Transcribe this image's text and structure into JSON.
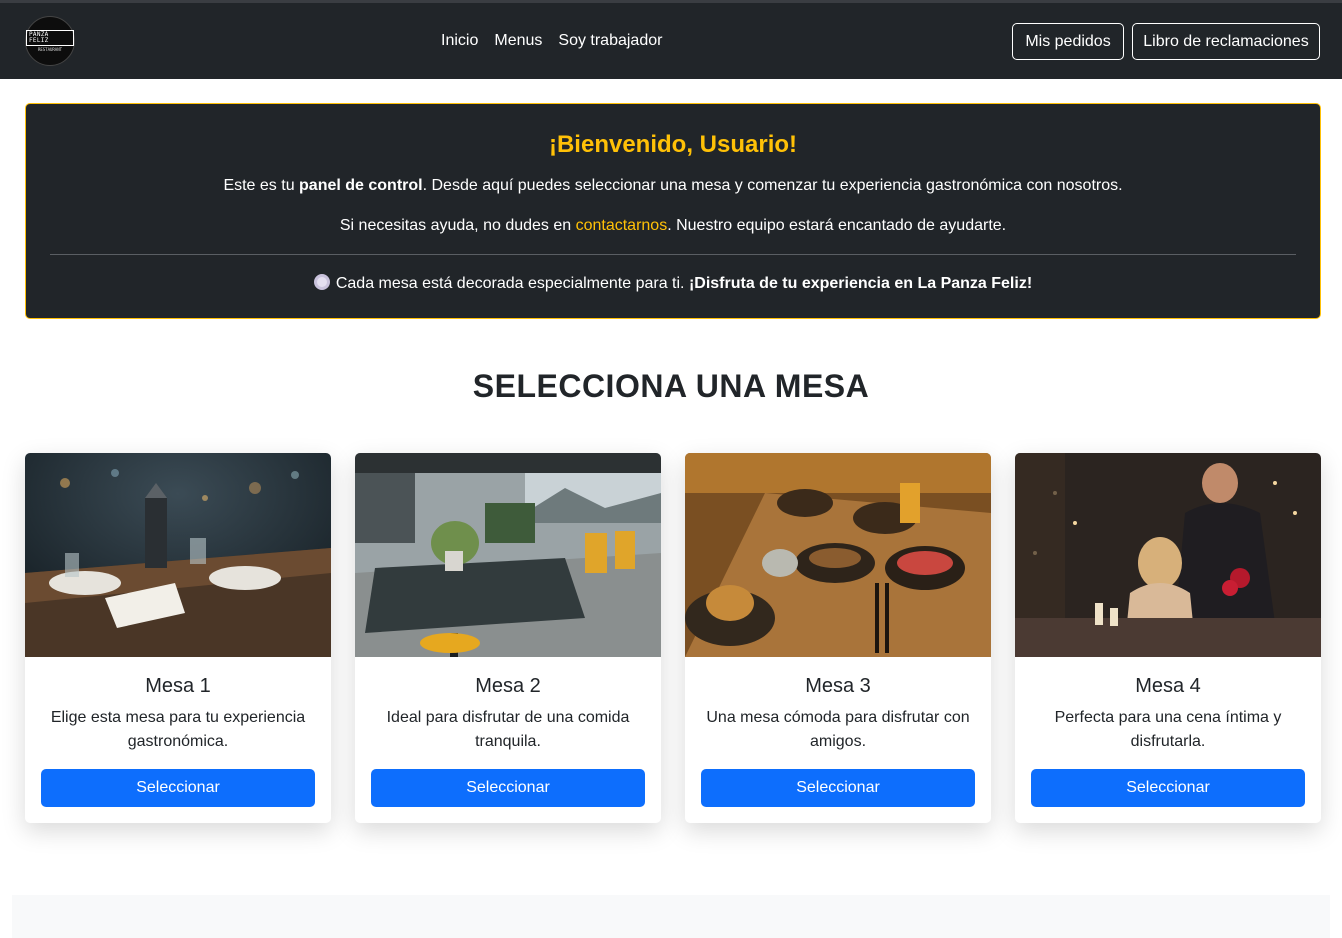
{
  "nav": {
    "logo_text": "PANZA FELIZ",
    "logo_sub": "RESTAURANT",
    "links": [
      "Inicio",
      "Menus",
      "Soy trabajador"
    ],
    "btn_pedidos": "Mis pedidos",
    "btn_reclamos": "Libro de reclamaciones"
  },
  "welcome": {
    "title": "¡Bienvenido, Usuario!",
    "p1_pre": "Este es tu ",
    "p1_bold": "panel de control",
    "p1_post": ". Desde aquí puedes seleccionar una mesa y comenzar tu experiencia gastronómica con nosotros.",
    "p2_pre": "Si necesitas ayuda, no dudes en ",
    "p2_link": "contactarnos",
    "p2_post": ". Nuestro equipo estará encantado de ayudarte.",
    "p3_pre": "Cada mesa está decorada especialmente para ti. ",
    "p3_bold": "¡Disfruta de tu experiencia en La Panza Feliz!"
  },
  "section_title": "SELECCIONA UNA MESA",
  "cards": [
    {
      "title": "Mesa 1",
      "text": "Elige esta mesa para tu experiencia gastronómica.",
      "button": "Seleccionar"
    },
    {
      "title": "Mesa 2",
      "text": "Ideal para disfrutar de una comida tranquila.",
      "button": "Seleccionar"
    },
    {
      "title": "Mesa 3",
      "text": "Una mesa cómoda para disfrutar con amigos.",
      "button": "Seleccionar"
    },
    {
      "title": "Mesa 4",
      "text": "Perfecta para una cena íntima y disfrutarla.",
      "button": "Seleccionar"
    }
  ],
  "colors": {
    "navbar": "#212529",
    "accent": "#ffc107",
    "primary_button": "#0d6efd"
  },
  "icons": [
    "plate-icon"
  ]
}
